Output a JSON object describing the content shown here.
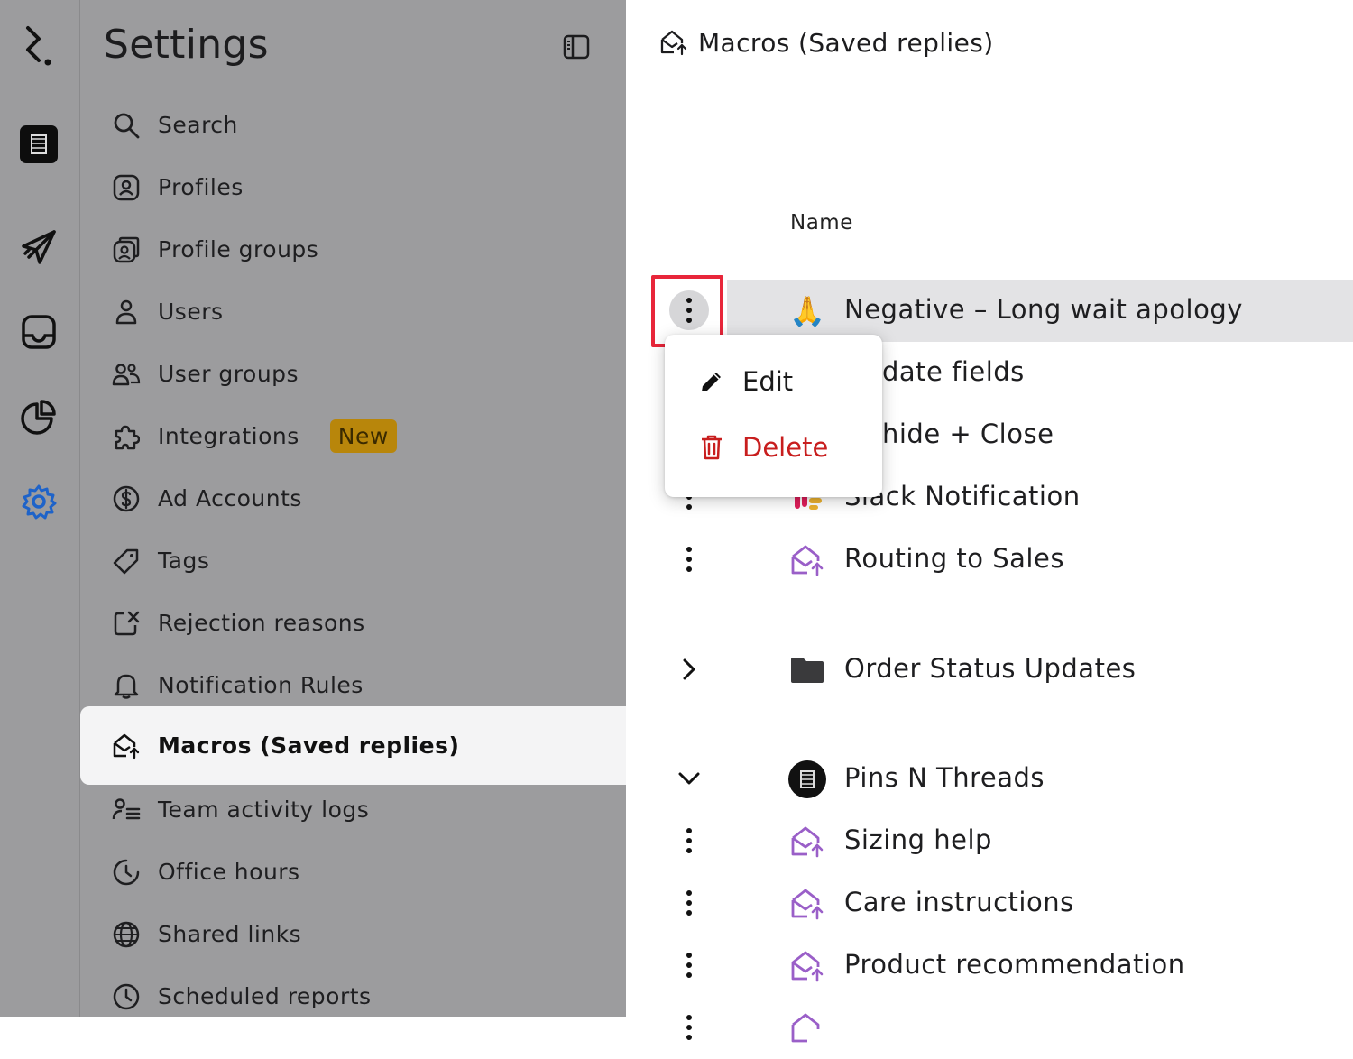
{
  "sidebar": {
    "title": "Settings",
    "items": [
      {
        "label": "Search",
        "icon": "search-icon"
      },
      {
        "label": "Profiles",
        "icon": "profile-icon"
      },
      {
        "label": "Profile groups",
        "icon": "profile-groups-icon"
      },
      {
        "label": "Users",
        "icon": "user-icon"
      },
      {
        "label": "User groups",
        "icon": "user-groups-icon"
      },
      {
        "label": "Integrations",
        "icon": "puzzle-icon",
        "badge": "New"
      },
      {
        "label": "Ad Accounts",
        "icon": "dollar-icon"
      },
      {
        "label": "Tags",
        "icon": "tag-icon"
      },
      {
        "label": "Rejection reasons",
        "icon": "rejection-icon"
      },
      {
        "label": "Notification Rules",
        "icon": "bell-icon"
      },
      {
        "label": "Macros (Saved replies)",
        "icon": "macro-icon",
        "active": true
      },
      {
        "label": "Team activity logs",
        "icon": "activity-log-icon"
      },
      {
        "label": "Office hours",
        "icon": "moon-clock-icon"
      },
      {
        "label": "Shared links",
        "icon": "globe-icon"
      },
      {
        "label": "Scheduled reports",
        "icon": "clock-icon"
      }
    ]
  },
  "rail": {
    "icons": [
      "logo-icon",
      "brand-icon",
      "send-icon",
      "inbox-icon",
      "analytics-icon",
      "gear-icon"
    ]
  },
  "main": {
    "title": "Macros (Saved replies)",
    "column_header": "Name",
    "rows": [
      {
        "label": "Negative – Long wait apology",
        "emoji": "🙏",
        "control": "kebab"
      },
      {
        "label": "date fields",
        "control": "kebab"
      },
      {
        "label": "hide + Close",
        "control": "kebab"
      },
      {
        "label": "Slack Notification",
        "control": "kebab"
      },
      {
        "label": "Routing to Sales",
        "control": "kebab"
      },
      {
        "label": "Order Status Updates",
        "control": "chevron-right"
      },
      {
        "label": "Pins N Threads",
        "control": "chevron-down"
      },
      {
        "label": "Sizing help",
        "control": "kebab"
      },
      {
        "label": "Care instructions",
        "control": "kebab"
      },
      {
        "label": "Product recommendation",
        "control": "kebab"
      }
    ]
  },
  "dropdown": {
    "edit_label": "Edit",
    "delete_label": "Delete"
  },
  "colors": {
    "overlay_gray": "#9c9c9e",
    "accent_blue": "#1e63c9",
    "macro_purple": "#9a5fc8",
    "danger_red": "#c81e1e",
    "focus_red": "#e8263a",
    "badge_amber": "#b8860b"
  }
}
